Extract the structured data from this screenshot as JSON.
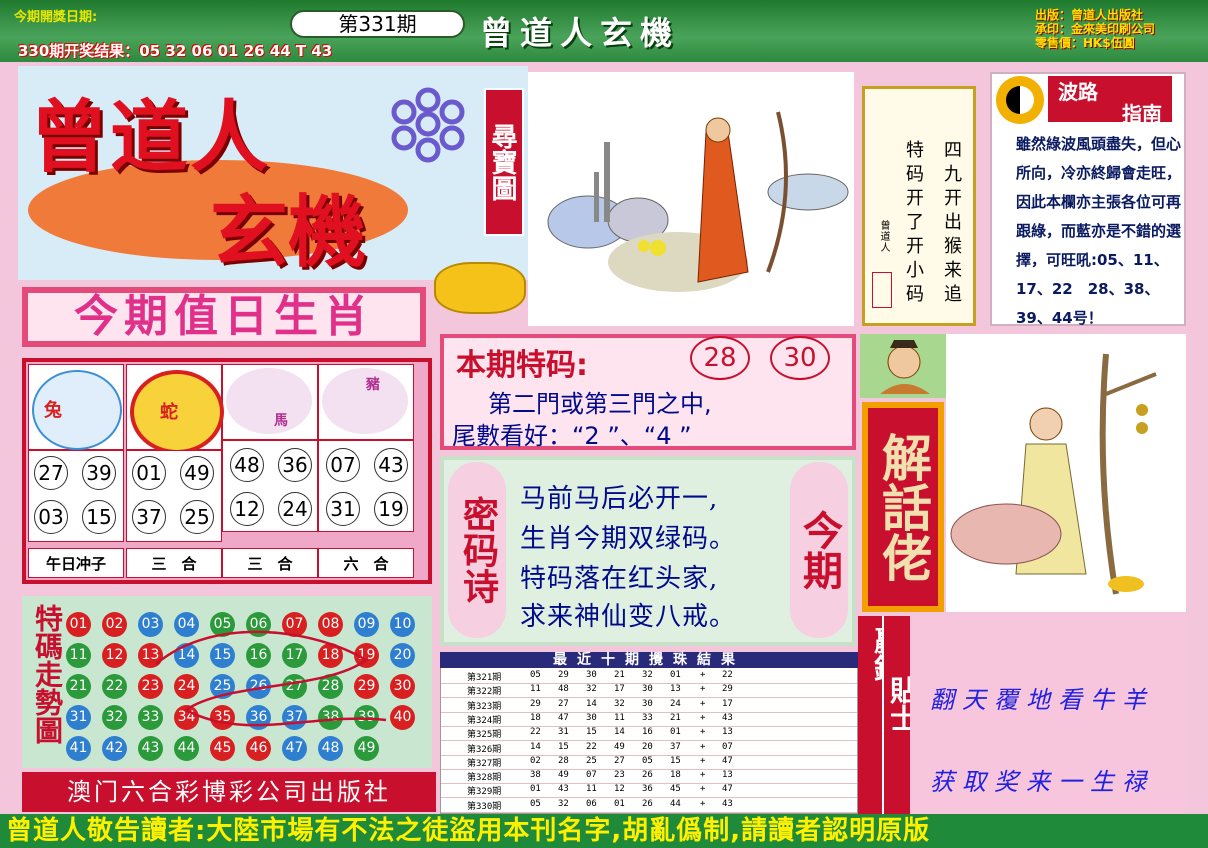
{
  "header": {
    "issue": "第331期",
    "title": "曾道人玄機",
    "left_note": "今期開獎日期:",
    "prev_result": "330期开奖结果：05 32 06 01 26 44 T 43",
    "publisher_info": [
      "出版：曾道人出版社",
      "承印：金來美印刷公司",
      "零售價：HK$伍圓"
    ]
  },
  "logo": {
    "line1": "曾道人",
    "line2": "玄機",
    "side_tag": "尋寶圖"
  },
  "zodiac": {
    "heading": "今期值日生肖",
    "animals": [
      {
        "name": "兔",
        "icon": "rabbit-icon",
        "color": "#3a8fd8"
      },
      {
        "name": "蛇",
        "icon": "snake-icon",
        "color": "#d82020"
      },
      {
        "name": "馬",
        "icon": "horse-icon",
        "color": "#b03090"
      },
      {
        "name": "豬",
        "icon": "pig-icon",
        "color": "#b03090"
      }
    ],
    "groups": [
      {
        "numbers": [
          "27",
          "39",
          "03",
          "15"
        ],
        "label": "午日冲子"
      },
      {
        "numbers": [
          "01",
          "49",
          "37",
          "25"
        ],
        "label": "三　合"
      },
      {
        "numbers": [
          "48",
          "36",
          "12",
          "24"
        ],
        "label": "三　合"
      },
      {
        "numbers": [
          "07",
          "43",
          "31",
          "19"
        ],
        "label": "六　合"
      }
    ]
  },
  "trend": {
    "title": "特碼走勢圖",
    "rows": [
      [
        [
          "01",
          "#d82020"
        ],
        [
          "02",
          "#d82020"
        ],
        [
          "03",
          "#2f7fd0"
        ],
        [
          "04",
          "#2f7fd0"
        ],
        [
          "05",
          "#2a9a3a"
        ],
        [
          "06",
          "#2a9a3a"
        ],
        [
          "07",
          "#d82020"
        ],
        [
          "08",
          "#d82020"
        ],
        [
          "09",
          "#2f7fd0"
        ],
        [
          "10",
          "#2f7fd0"
        ]
      ],
      [
        [
          "11",
          "#2a9a3a"
        ],
        [
          "12",
          "#d82020"
        ],
        [
          "13",
          "#d82020"
        ],
        [
          "14",
          "#2f7fd0"
        ],
        [
          "15",
          "#2f7fd0"
        ],
        [
          "16",
          "#2a9a3a"
        ],
        [
          "17",
          "#2a9a3a"
        ],
        [
          "18",
          "#d82020"
        ],
        [
          "19",
          "#d82020"
        ],
        [
          "20",
          "#2f7fd0"
        ]
      ],
      [
        [
          "21",
          "#2a9a3a"
        ],
        [
          "22",
          "#2a9a3a"
        ],
        [
          "23",
          "#d82020"
        ],
        [
          "24",
          "#d82020"
        ],
        [
          "25",
          "#2f7fd0"
        ],
        [
          "26",
          "#2f7fd0"
        ],
        [
          "27",
          "#2a9a3a"
        ],
        [
          "28",
          "#2a9a3a"
        ],
        [
          "29",
          "#d82020"
        ],
        [
          "30",
          "#d82020"
        ]
      ],
      [
        [
          "31",
          "#2f7fd0"
        ],
        [
          "32",
          "#2a9a3a"
        ],
        [
          "33",
          "#2a9a3a"
        ],
        [
          "34",
          "#d82020"
        ],
        [
          "35",
          "#d82020"
        ],
        [
          "36",
          "#2f7fd0"
        ],
        [
          "37",
          "#2f7fd0"
        ],
        [
          "38",
          "#2a9a3a"
        ],
        [
          "39",
          "#2a9a3a"
        ],
        [
          "40",
          "#d82020"
        ]
      ],
      [
        [
          "41",
          "#2f7fd0"
        ],
        [
          "42",
          "#2f7fd0"
        ],
        [
          "43",
          "#2a9a3a"
        ],
        [
          "44",
          "#2a9a3a"
        ],
        [
          "45",
          "#d82020"
        ],
        [
          "46",
          "#d82020"
        ],
        [
          "47",
          "#2f7fd0"
        ],
        [
          "48",
          "#2f7fd0"
        ],
        [
          "49",
          "#2a9a3a"
        ]
      ]
    ]
  },
  "publisher": "澳门六合彩博彩公司出版社",
  "footer": "曾道人敬告讀者:大陸市場有不法之徒盜用本刊名字,胡亂僞制,請讀者認明原版",
  "poem": {
    "col1": "特码开了开小码",
    "col2": "四九开出猴来追",
    "signature": "曾道人"
  },
  "wave": {
    "title_top": "波路",
    "title_bottom": "指南",
    "text": "雖然綠波風頭盡失，但心所向，冷亦終歸會走旺，因此本欄亦主張各位可再跟綠，而藍亦是不錯的選擇，可旺吼:05、11、17、22　28、38、39、44号！"
  },
  "special": {
    "title": "本期特码:",
    "num1": "28",
    "num2": "30",
    "line1": "第二門或第三門之中,",
    "line2": "尾數看好：“2 ”、“4 ”"
  },
  "mima": {
    "left": "密码诗",
    "right": "今期",
    "lines": [
      "马前马后必开一,",
      "生肖今期双绿码。",
      "特码落在红头家,",
      "求来神仙变八戒。"
    ]
  },
  "results": {
    "heading": "最近十期攪珠結果",
    "rows": [
      [
        "第321期",
        "05",
        "29",
        "30",
        "21",
        "32",
        "01",
        "+",
        "22"
      ],
      [
        "第322期",
        "11",
        "48",
        "32",
        "17",
        "30",
        "13",
        "+",
        "29"
      ],
      [
        "第323期",
        "29",
        "27",
        "14",
        "32",
        "30",
        "24",
        "+",
        "17"
      ],
      [
        "第324期",
        "18",
        "47",
        "30",
        "11",
        "33",
        "21",
        "+",
        "43"
      ],
      [
        "第325期",
        "22",
        "31",
        "15",
        "14",
        "16",
        "01",
        "+",
        "13"
      ],
      [
        "第326期",
        "14",
        "15",
        "22",
        "49",
        "20",
        "37",
        "+",
        "07"
      ],
      [
        "第327期",
        "02",
        "28",
        "25",
        "27",
        "05",
        "15",
        "+",
        "47"
      ],
      [
        "第328期",
        "38",
        "49",
        "07",
        "23",
        "26",
        "18",
        "+",
        "13"
      ],
      [
        "第329期",
        "01",
        "43",
        "11",
        "12",
        "36",
        "45",
        "+",
        "47"
      ],
      [
        "第330期",
        "05",
        "32",
        "06",
        "01",
        "26",
        "44",
        "+",
        "43"
      ]
    ]
  },
  "jiehua": "解話佬",
  "tips": {
    "label1": "贏錢",
    "label2": "貼士",
    "line1": "翻天覆地看牛羊",
    "line2": "获取奖来一生禄"
  }
}
